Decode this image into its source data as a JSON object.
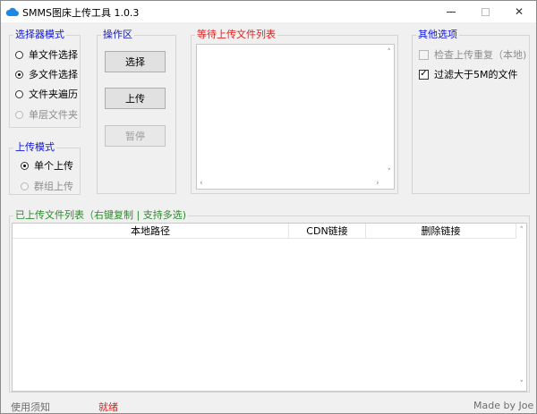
{
  "window": {
    "title": "SMMS图床上传工具 1.0.3"
  },
  "selector_mode": {
    "label": "选择器模式",
    "options": [
      {
        "label": "单文件选择",
        "selected": false,
        "enabled": true
      },
      {
        "label": "多文件选择",
        "selected": true,
        "enabled": true
      },
      {
        "label": "文件夹遍历",
        "selected": false,
        "enabled": true
      },
      {
        "label": "单层文件夹",
        "selected": false,
        "enabled": false
      }
    ]
  },
  "upload_mode": {
    "label": "上传模式",
    "options": [
      {
        "label": "单个上传",
        "selected": true,
        "enabled": true
      },
      {
        "label": "群组上传",
        "selected": false,
        "enabled": false
      }
    ]
  },
  "operations": {
    "label": "操作区",
    "select_label": "选择",
    "upload_label": "上传",
    "pause_label": "暂停"
  },
  "pending": {
    "label": "等待上传文件列表"
  },
  "other_options": {
    "label": "其他选项",
    "check_duplicates": {
      "label": "检查上传重复（本地)",
      "checked": false,
      "enabled": false
    },
    "filter_large": {
      "label": "过滤大于5M的文件",
      "checked": true,
      "enabled": true
    }
  },
  "uploaded": {
    "label": "已上传文件列表（右键复制 | 支持多选)",
    "columns": [
      "本地路径",
      "CDN链接",
      "删除链接"
    ]
  },
  "status_bar": {
    "help": "使用须知",
    "state": "就绪",
    "credit": "Made by Joe"
  },
  "colors": {
    "accent_blue": "#0f14d8",
    "accent_red": "#e0201e",
    "accent_green": "#2b8a2b"
  }
}
